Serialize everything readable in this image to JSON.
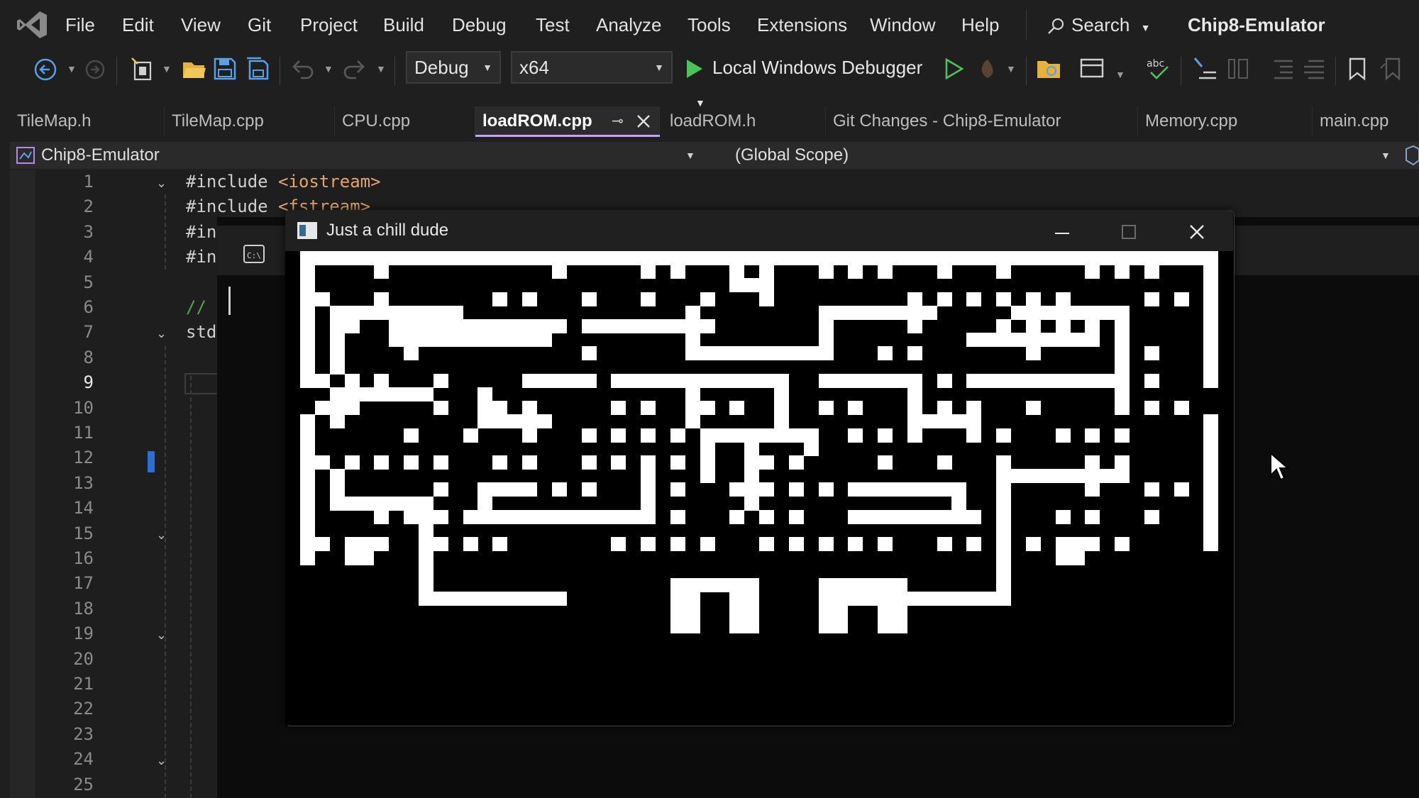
{
  "menubar": {
    "items": [
      "File",
      "Edit",
      "View",
      "Git",
      "Project",
      "Build",
      "Debug",
      "Test",
      "Analyze",
      "Tools",
      "Extensions",
      "Window",
      "Help"
    ],
    "search_label": "Search",
    "project_title": "Chip8-Emulator"
  },
  "toolbar": {
    "config": "Debug",
    "platform": "x64",
    "debugger": "Local Windows Debugger"
  },
  "tabs": [
    {
      "label": "TileMap.h"
    },
    {
      "label": "TileMap.cpp"
    },
    {
      "label": "CPU.cpp"
    },
    {
      "label": "loadROM.cpp",
      "active": true
    },
    {
      "label": "loadROM.h"
    },
    {
      "label": "Git Changes - Chip8-Emulator"
    },
    {
      "label": "Memory.cpp"
    },
    {
      "label": "main.cpp"
    }
  ],
  "navbar": {
    "project": "Chip8-Emulator",
    "scope": "(Global Scope)"
  },
  "editor": {
    "line_numbers": [
      "1",
      "2",
      "3",
      "4",
      "5",
      "6",
      "7",
      "8",
      "9",
      "10",
      "11",
      "12",
      "13",
      "14",
      "15",
      "16",
      "17",
      "18",
      "19",
      "20",
      "21",
      "22",
      "23",
      "24",
      "25"
    ],
    "current_line": "9",
    "lines": {
      "l1": "#include ",
      "l1_str": "<iostream>",
      "l2": "#include ",
      "l2_str": "<fstream>",
      "l3": "#in",
      "l4": "#in",
      "l6": "//",
      "l7": "std"
    }
  },
  "emulator_window": {
    "title": "Just a chill dude"
  }
}
